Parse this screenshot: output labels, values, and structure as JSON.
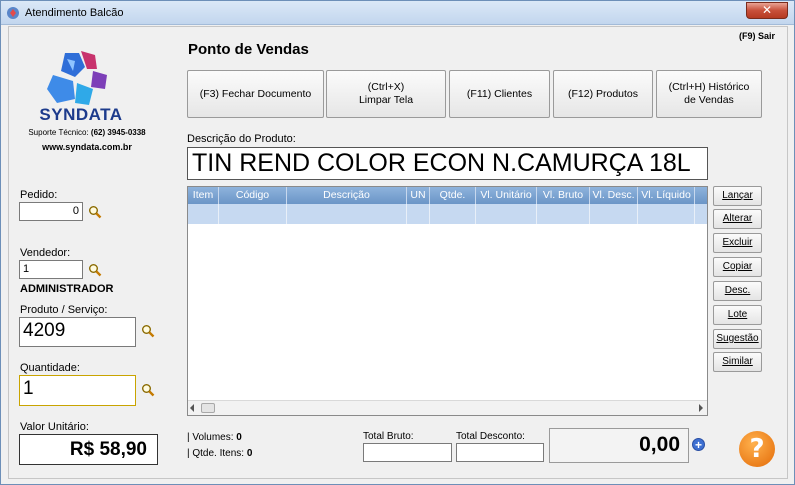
{
  "window": {
    "title": "Atendimento Balcão",
    "close_glyph": "✕"
  },
  "brand": {
    "name": "SYNDATA",
    "support_label": "Suporte Técnico:",
    "support_phone": "(62) 3945-0338",
    "website": "www.syndata.com.br"
  },
  "left": {
    "pedido_label": "Pedido:",
    "pedido_value": "0",
    "vendedor_label": "Vendedor:",
    "vendedor_value": "1",
    "vendedor_name": "ADMINISTRADOR",
    "produto_label": "Produto / Serviço:",
    "produto_value": "4209",
    "quantidade_label": "Quantidade:",
    "quantidade_value": "1",
    "valor_label": "Valor Unitário:",
    "valor_value": "R$ 58,90"
  },
  "header": {
    "title": "Ponto de Vendas",
    "exit": "(F9) Sair"
  },
  "toolbar": {
    "fechar": "(F3) Fechar Documento",
    "limpar_line1": "(Ctrl+X)",
    "limpar_line2": "Limpar Tela",
    "clientes": "(F11) Clientes",
    "produtos": "(F12) Produtos",
    "historico_line1": "(Ctrl+H) Histórico",
    "historico_line2": "de Vendas"
  },
  "product": {
    "label": "Descrição do Produto:",
    "description": "TIN REND COLOR ECON N.CAMURÇA 18L"
  },
  "grid": {
    "columns": [
      "Item",
      "Código",
      "Descrição",
      "UN",
      "Qtde.",
      "Vl. Unitário",
      "Vl. Bruto",
      "Vl. Desc.",
      "Vl. Líquido"
    ]
  },
  "side_buttons": {
    "lancar": "Lançar",
    "alterar": "Alterar",
    "excluir": "Excluir",
    "copiar": "Copiar",
    "desc": "Desc.",
    "lote": "Lote",
    "sugestao": "Sugestão",
    "similar": "Similar"
  },
  "footer": {
    "volumes_label": "| Volumes:",
    "volumes_value": "0",
    "itens_label": "| Qtde. Itens:",
    "itens_value": "0",
    "total_bruto_label": "Total Bruto:",
    "total_desconto_label": "Total Desconto:",
    "total_value": "0,00",
    "plus_glyph": "+",
    "help_glyph": "?"
  },
  "colors": {
    "grid_header": "#7ba3d3",
    "grid_selected_row": "#c6d9f1",
    "brand_blue": "#1d3b8c",
    "help_orange": "#f08a1c"
  }
}
